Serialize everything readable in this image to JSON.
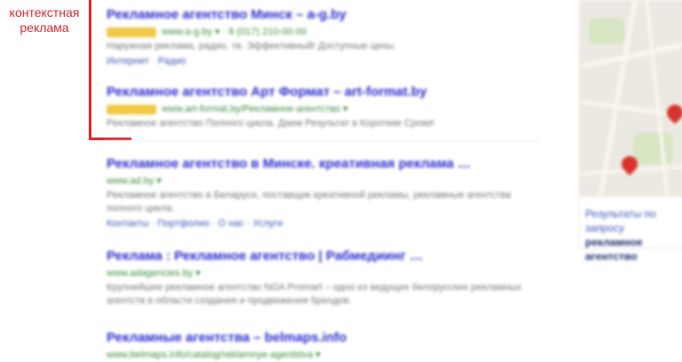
{
  "annotation": {
    "label": "контекстная реклама"
  },
  "results": [
    {
      "title": "Рекламное агентство Минск – a-g.by",
      "ad_badge": "Реклама",
      "url": "www.a-g.by ▾  ·  8 (017) 210-00-00",
      "snippet": "Наружная реклама, радио, тв. Эффективный! Доступные цены.",
      "links": "Интернет · Радио"
    },
    {
      "title": "Рекламное агентство Арт Формат – art-format.by",
      "ad_badge": "Реклама",
      "url": "www.art-format.by/Рекламное-агентство ▾",
      "snippet": "Рекламное агентство Полного цикла. Даем Результат в Короткие Сроки!",
      "links": ""
    },
    {
      "title": "Рекламное агентство в Минске. креативная реклама …",
      "ad_badge": "",
      "url": "www.ad.by ▾",
      "snippet": "Рекламное агентство в Беларуси, поставщик креативной рекламы, рекламные агентства полного цикла.",
      "links": "Контакты · Портфолио · О нас · Услуги"
    },
    {
      "title": "Реклама : Рекламное агентство | Рабмедиинг …",
      "ad_badge": "",
      "url": "www.adagencies.by ▾",
      "snippet": "Крупнейшее рекламное агентство NGA Promart – одно из ведущих белорусских рекламных агентств в области создания и продвижения брендов.",
      "links": ""
    },
    {
      "title": "Рекламные агентства – belmaps.info",
      "ad_badge": "",
      "url": "www.belmaps.info/catalog/reklamnye-agentstva ▾",
      "snippet": "",
      "links": ""
    }
  ],
  "map": {
    "caption_line1": "Результаты по запросу",
    "caption_line2": "рекламное агентство"
  }
}
